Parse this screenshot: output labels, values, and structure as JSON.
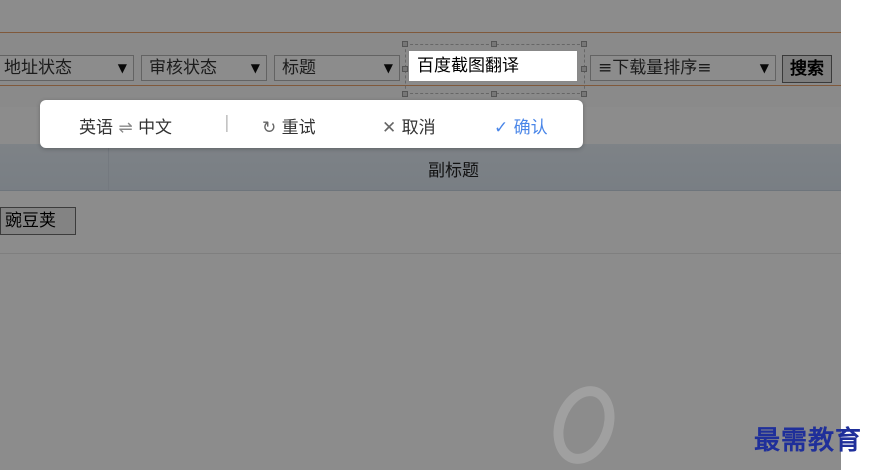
{
  "toolbar": {
    "filters": [
      {
        "label": "地址状态",
        "arrow": "▼"
      },
      {
        "label": "审核状态",
        "arrow": "▼"
      },
      {
        "label": "标题",
        "arrow": "▼"
      }
    ],
    "search_value": "百度截图翻译",
    "sort": {
      "label": "≡下载量排序≡",
      "arrow": "▼"
    },
    "search_label": "搜索"
  },
  "translate_bar": {
    "source_lang": "英语",
    "swap": "⇌",
    "target_lang": "中文",
    "divider": "|",
    "retry_icon": "↻",
    "retry_label": "重试",
    "cancel_icon": "✕",
    "cancel_label": "取消",
    "confirm_icon": "✓",
    "confirm_label": "确认",
    "confirm_color": "#4a86e8"
  },
  "table": {
    "header": {
      "subtitle": "副标题"
    },
    "rows": [
      {
        "tag": "豌豆荚"
      }
    ]
  },
  "brand": {
    "text": "最需教育"
  }
}
